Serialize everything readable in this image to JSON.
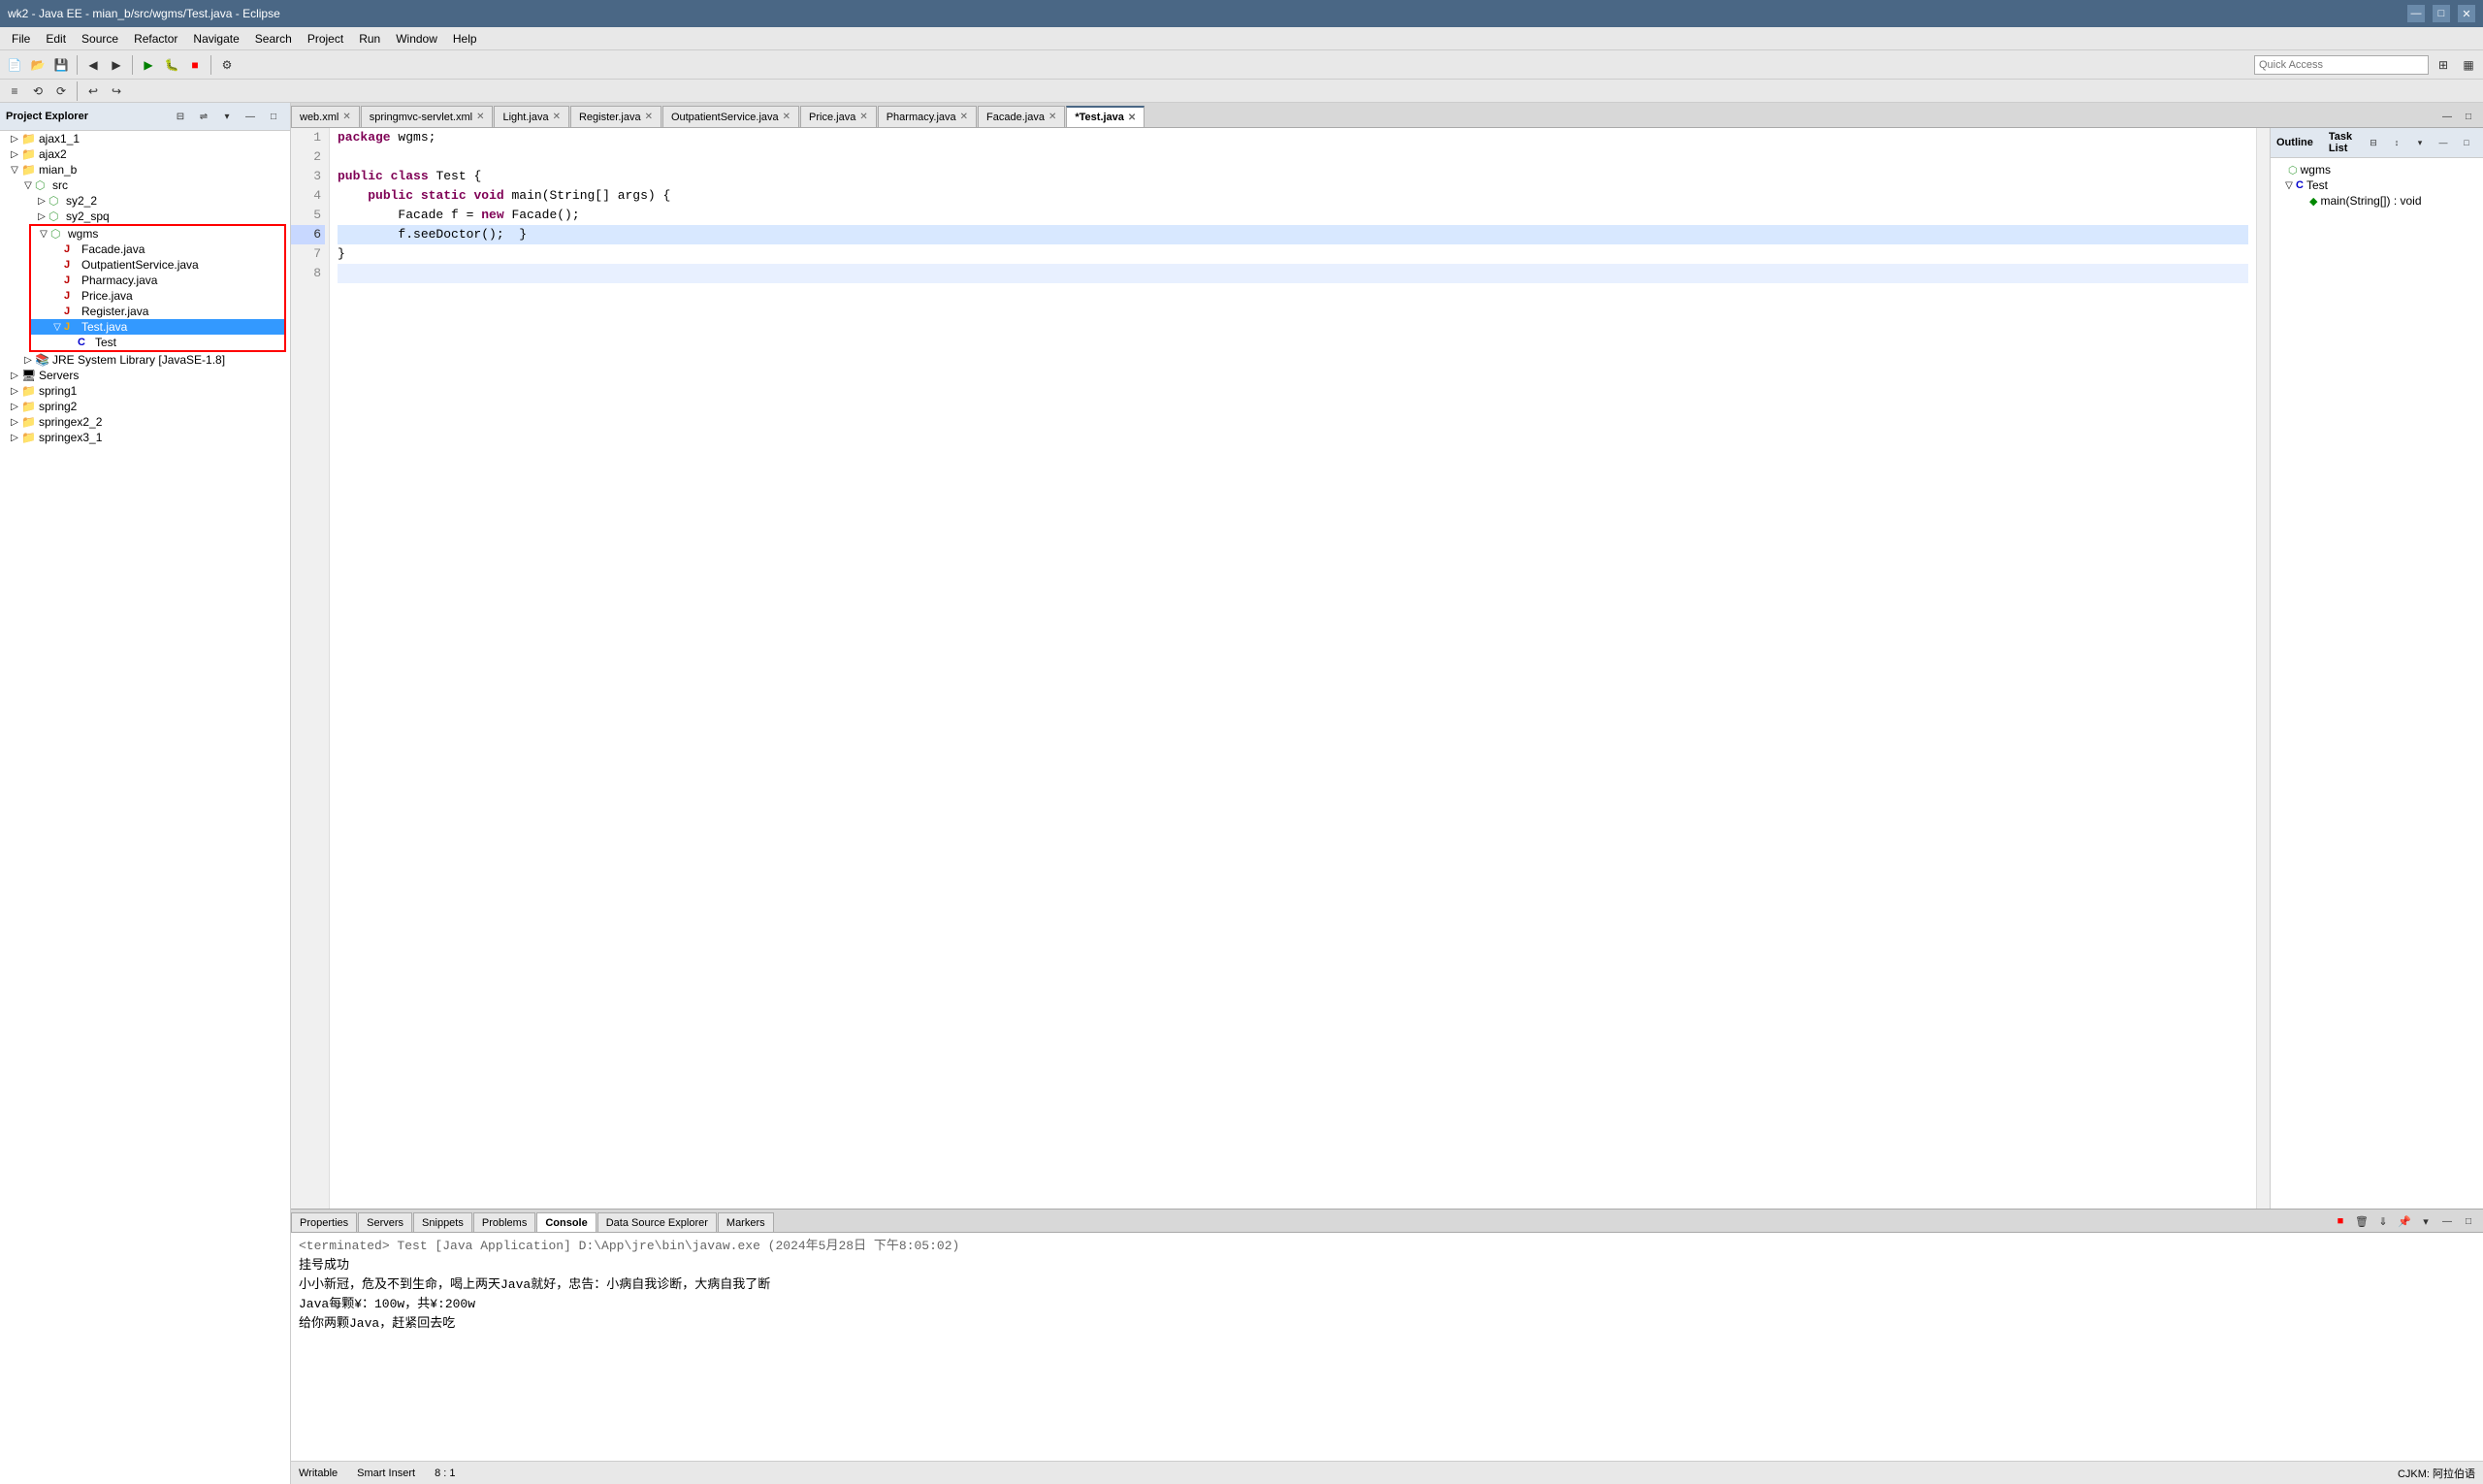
{
  "titlebar": {
    "title": "wk2 - Java EE - mian_b/src/wgms/Test.java - Eclipse",
    "min_btn": "—",
    "max_btn": "□",
    "close_btn": "✕"
  },
  "menubar": {
    "items": [
      "File",
      "Edit",
      "Source",
      "Refactor",
      "Navigate",
      "Search",
      "Project",
      "Run",
      "Window",
      "Help"
    ]
  },
  "toolbar": {
    "quick_access_label": "Quick Access"
  },
  "project_explorer": {
    "title": "Project Explorer",
    "items": [
      {
        "id": "ajax1_1",
        "label": "ajax1_1",
        "level": 1,
        "toggle": "▷",
        "icon": "📁"
      },
      {
        "id": "ajax2",
        "label": "ajax2",
        "level": 1,
        "toggle": "▷",
        "icon": "📁"
      },
      {
        "id": "mian_b",
        "label": "mian_b",
        "level": 1,
        "toggle": "▽",
        "icon": "📁"
      },
      {
        "id": "src",
        "label": "src",
        "level": 2,
        "toggle": "▽",
        "icon": "📦"
      },
      {
        "id": "sy2_2",
        "label": "sy2_2",
        "level": 3,
        "toggle": "▷",
        "icon": "📦"
      },
      {
        "id": "sy2_spq",
        "label": "sy2_spq",
        "level": 3,
        "toggle": "▷",
        "icon": "📦"
      },
      {
        "id": "wgms",
        "label": "wgms",
        "level": 3,
        "toggle": "▽",
        "icon": "📦"
      },
      {
        "id": "Facade.java",
        "label": "Facade.java",
        "level": 4,
        "icon": "J",
        "highlighted": true
      },
      {
        "id": "OutpatientService.java",
        "label": "OutpatientService.java",
        "level": 4,
        "icon": "J",
        "highlighted": true
      },
      {
        "id": "Pharmacy.java",
        "label": "Pharmacy.java",
        "level": 4,
        "icon": "J",
        "highlighted": true
      },
      {
        "id": "Price.java",
        "label": "Price.java",
        "level": 4,
        "icon": "J",
        "highlighted": true
      },
      {
        "id": "Register.java",
        "label": "Register.java",
        "level": 4,
        "icon": "J",
        "highlighted": true
      },
      {
        "id": "Test.java",
        "label": "Test.java",
        "level": 4,
        "icon": "J",
        "highlighted": true,
        "selected": true
      },
      {
        "id": "Test_inner",
        "label": "Test",
        "level": 5,
        "icon": "C",
        "highlighted": true
      },
      {
        "id": "JRE",
        "label": "JRE System Library [JavaSE-1.8]",
        "level": 2,
        "toggle": "▷",
        "icon": "📚"
      },
      {
        "id": "Servers",
        "label": "Servers",
        "level": 1,
        "toggle": "▷",
        "icon": "🖥"
      },
      {
        "id": "spring1",
        "label": "spring1",
        "level": 1,
        "toggle": "▷",
        "icon": "📁"
      },
      {
        "id": "spring2",
        "label": "spring2",
        "level": 1,
        "toggle": "▷",
        "icon": "📁"
      },
      {
        "id": "springex2_2",
        "label": "springex2_2",
        "level": 1,
        "toggle": "▷",
        "icon": "📁"
      },
      {
        "id": "springex3_1",
        "label": "springex3_1",
        "level": 1,
        "toggle": "▷",
        "icon": "📁"
      }
    ]
  },
  "editor": {
    "tabs": [
      {
        "label": "web.xml",
        "dirty": false,
        "active": false
      },
      {
        "label": "springmvc-servlet.xml",
        "dirty": false,
        "active": false
      },
      {
        "label": "Light.java",
        "dirty": false,
        "active": false
      },
      {
        "label": "Register.java",
        "dirty": false,
        "active": false
      },
      {
        "label": "OutpatientService.java",
        "dirty": false,
        "active": false
      },
      {
        "label": "Price.java",
        "dirty": false,
        "active": false
      },
      {
        "label": "Pharmacy.java",
        "dirty": false,
        "active": false
      },
      {
        "label": "Facade.java",
        "dirty": false,
        "active": false
      },
      {
        "label": "*Test.java",
        "dirty": true,
        "active": true
      }
    ],
    "lines": [
      {
        "num": 1,
        "text": "package wgms;",
        "highlighted": false
      },
      {
        "num": 2,
        "text": "",
        "highlighted": false
      },
      {
        "num": 3,
        "text": "public class Test {",
        "highlighted": false
      },
      {
        "num": 4,
        "text": "    public static void main(String[] args) {",
        "highlighted": false
      },
      {
        "num": 5,
        "text": "        Facade f = new Facade();",
        "highlighted": false
      },
      {
        "num": 6,
        "text": "        f.seeDoctor();  }",
        "highlighted": true
      },
      {
        "num": 7,
        "text": "}",
        "highlighted": false
      },
      {
        "num": 8,
        "text": "",
        "highlighted": false
      }
    ]
  },
  "outline": {
    "title": "Outline",
    "task_list_label": "Task List",
    "items": [
      {
        "label": "wgms",
        "icon": "pkg",
        "level": 1
      },
      {
        "label": "Test",
        "icon": "class",
        "level": 2,
        "toggle": "▽"
      },
      {
        "label": "main(String[]) : void",
        "icon": "method",
        "level": 3
      }
    ]
  },
  "bottom_panel": {
    "tabs": [
      "Properties",
      "Servers",
      "Snippets",
      "Problems",
      "Console",
      "Data Source Explorer",
      "Markers"
    ],
    "active_tab": "Console",
    "console": {
      "terminated_line": "<terminated> Test [Java Application] D:\\App\\jre\\bin\\javaw.exe (2024年5月28日 下午8:05:02)",
      "output_lines": [
        "挂号成功",
        "小小新冠，危及不到生命，喝上两天Java就好，忠告：小病自我诊断，大病自我了断",
        "Java每颗¥：100w，共¥:200w",
        "给你两颗Java，赶紧回去吃"
      ]
    }
  },
  "statusbar": {
    "writable": "Writable",
    "smart_insert": "Smart Insert",
    "position": "8 : 1"
  }
}
